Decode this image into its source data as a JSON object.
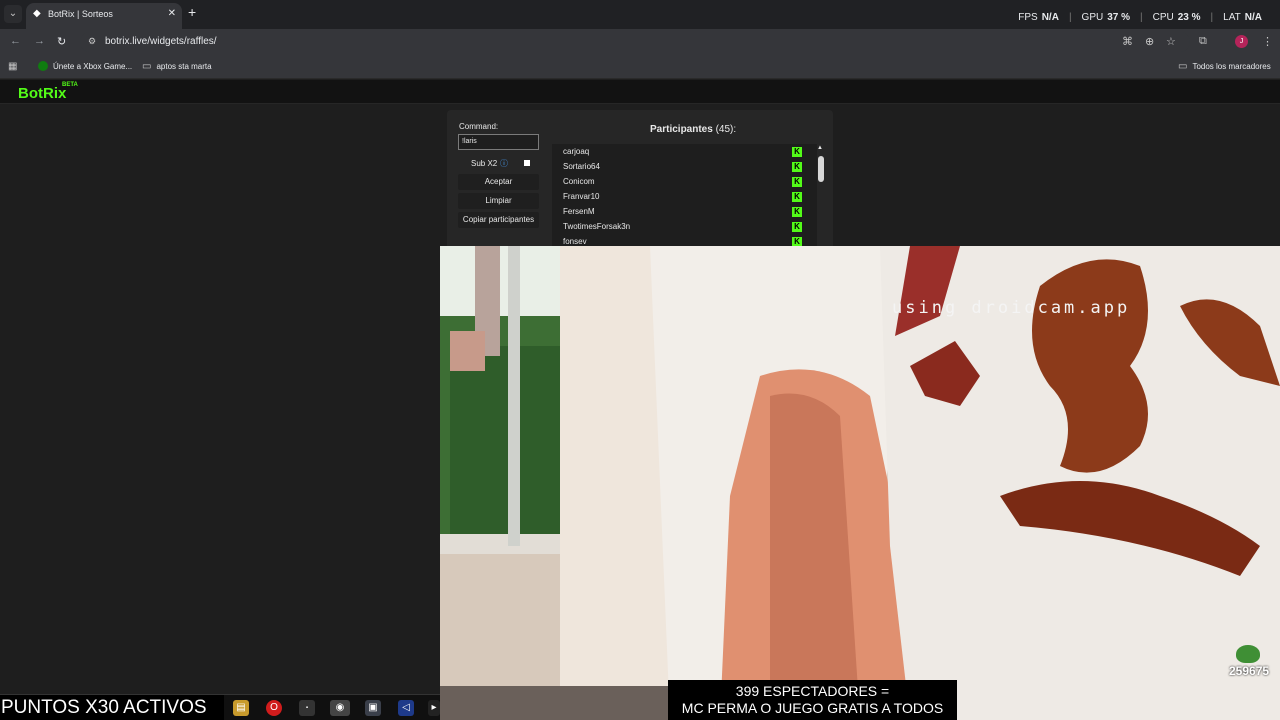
{
  "browser": {
    "tab_title": "BotRix | Sorteos",
    "url": "botrix.live/widgets/raffles/",
    "stats": {
      "fps_label": "FPS",
      "fps_value": "N/A",
      "gpu_label": "GPU",
      "gpu_value": "37 %",
      "cpu_label": "CPU",
      "cpu_value": "23 %",
      "lat_label": "LAT",
      "lat_value": "N/A"
    },
    "profile_initial": "J",
    "bookmarks": [
      {
        "label": "Únete a Xbox Game...",
        "icon": "xbox-icon"
      },
      {
        "label": "aptos sta marta",
        "icon": "folder-icon"
      }
    ],
    "all_bookmarks_label": "Todos los marcadores"
  },
  "site": {
    "logo": "BotRix",
    "beta": "BETA"
  },
  "raffle": {
    "command_label": "Command:",
    "command_value": "!laris",
    "sub_label": "Sub X2",
    "accept_label": "Aceptar",
    "clear_label": "Limpiar",
    "copy_label": "Copiar participantes",
    "participants_title": "Participantes",
    "participants_count": "(45):",
    "participants": [
      {
        "name": "carjoaq"
      },
      {
        "name": "Sortario64"
      },
      {
        "name": "Conicom"
      },
      {
        "name": "Franvar10"
      },
      {
        "name": "FersenM"
      },
      {
        "name": "TwotimesForsak3n"
      },
      {
        "name": "fonsev"
      }
    ],
    "platform_icon": "kick-icon",
    "platform_letter": "K"
  },
  "stream": {
    "watermark": "using droidcam.app",
    "banner_line1": "399 ESPECTADORES =",
    "banner_line2": "MC PERMA O JUEGO GRATIS A TODOS",
    "points_counter": "259675",
    "points_banner": "PUNTOS X30 ACTIVOS"
  },
  "colors": {
    "kick_green": "#53fc18",
    "panel_bg": "#262626",
    "browser_bg": "#35363a"
  }
}
